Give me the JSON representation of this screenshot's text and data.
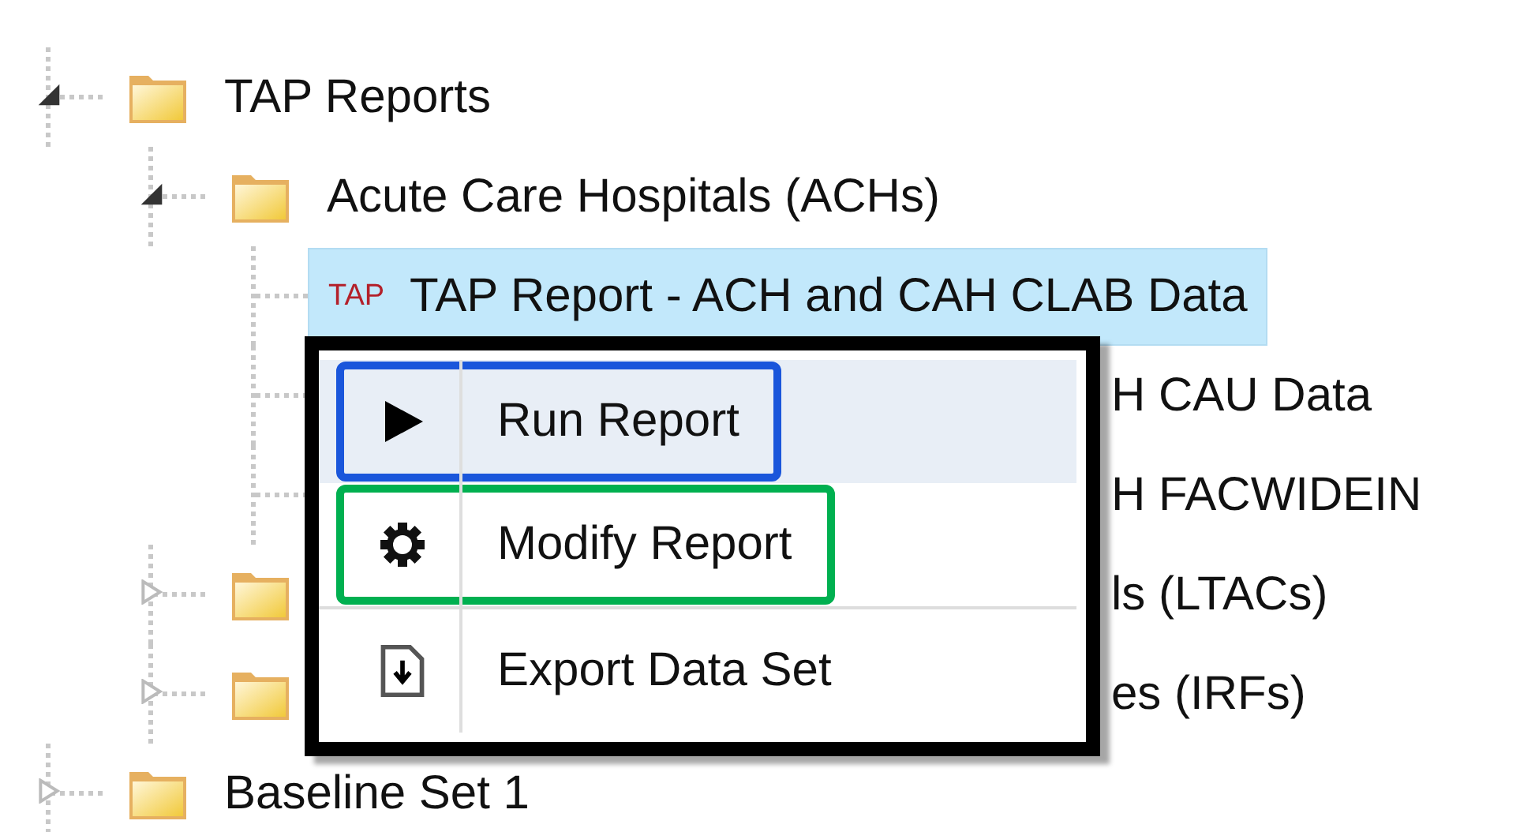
{
  "tree": [
    {
      "kind": "folder",
      "label": "TAP Reports",
      "expanded": true,
      "selected": false,
      "children": [
        {
          "kind": "folder",
          "label": "Acute Care Hospitals (ACHs)",
          "expanded": true,
          "selected": false,
          "children": [
            {
              "kind": "report",
              "badge": "TAP",
              "label": "TAP Report - ACH and CAH CLAB Data",
              "selected": true
            },
            {
              "kind": "covered_report",
              "label": "H CAU Data",
              "selected": false
            },
            {
              "kind": "covered_report",
              "label": "H FACWIDEIN",
              "selected": false
            }
          ]
        },
        {
          "kind": "covered_folder",
          "label": "ls (LTACs)",
          "expanded": false,
          "selected": false
        },
        {
          "kind": "covered_folder",
          "label": "es (IRFs)",
          "expanded": false,
          "selected": false
        }
      ]
    },
    {
      "kind": "folder",
      "label": "Baseline Set 1",
      "expanded": false,
      "selected": false
    }
  ],
  "context_menu": {
    "items": [
      {
        "kind": "play",
        "label": "Run Report",
        "selected": true,
        "color": "#1a56db"
      },
      {
        "kind": "gear",
        "label": "Modify Report",
        "selected": false,
        "color": "#00b050"
      },
      {
        "kind": "download",
        "label": "Export Data Set",
        "selected": false
      }
    ]
  }
}
